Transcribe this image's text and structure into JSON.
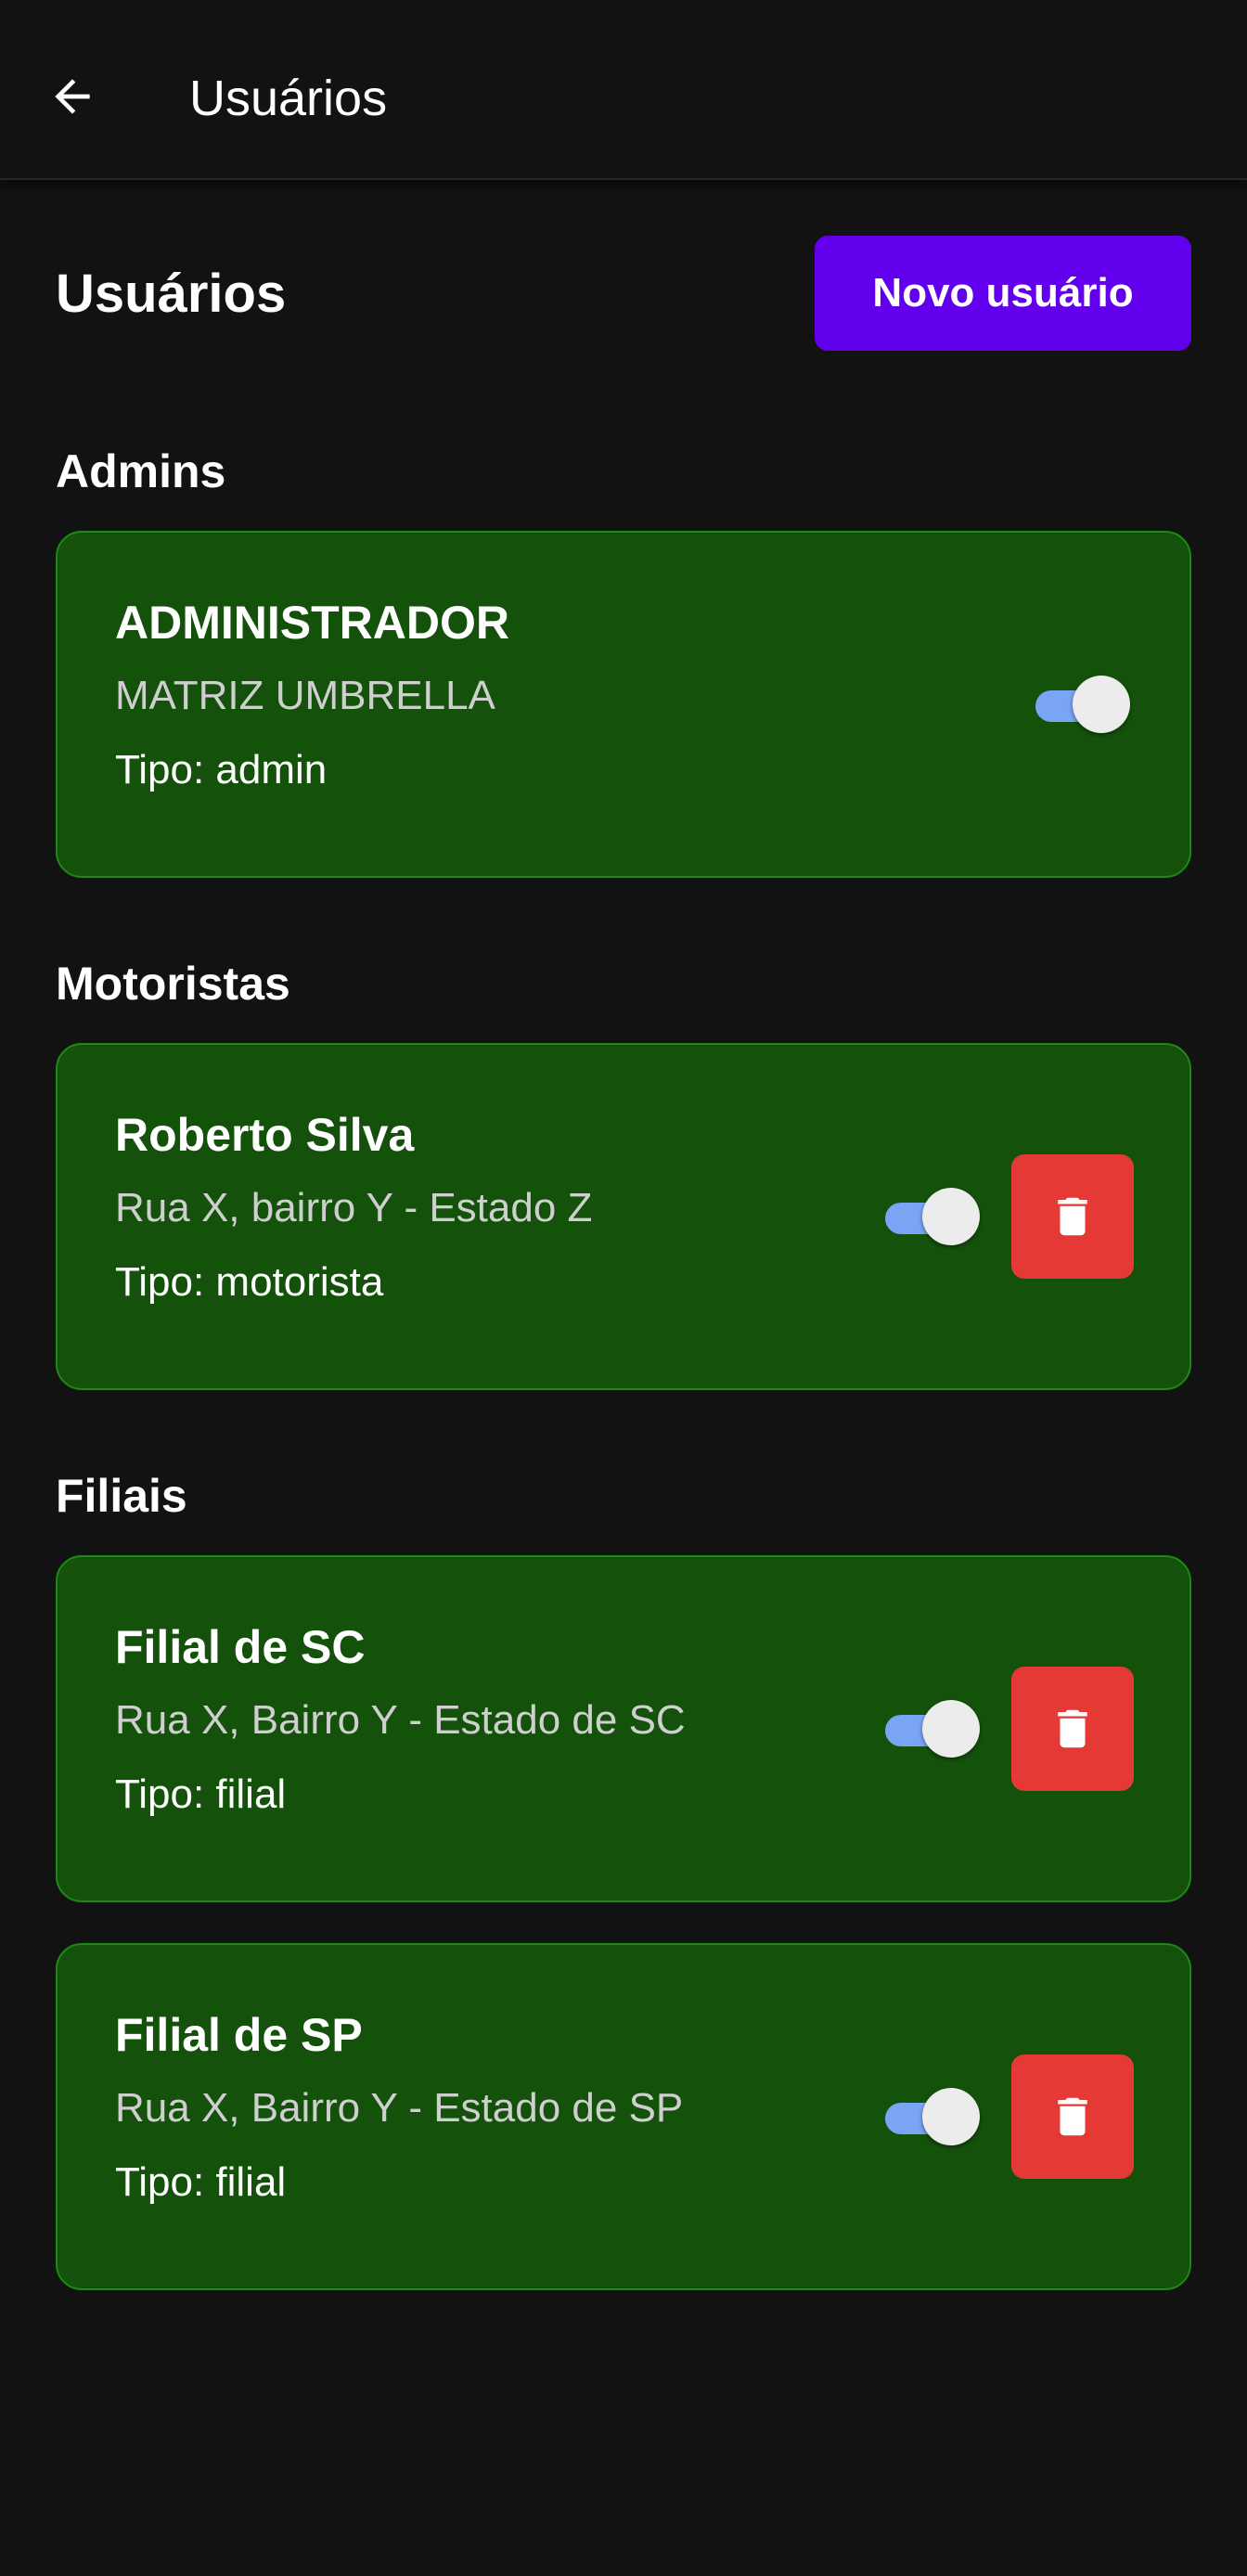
{
  "appbar": {
    "title": "Usuários",
    "back_icon": "arrow-left-icon"
  },
  "header": {
    "title": "Usuários",
    "new_user_label": "Novo usuário"
  },
  "colors": {
    "primary": "#6200ee",
    "card_bg": "#14520c",
    "card_border": "#1c8a14",
    "delete": "#e53935",
    "switch_track": "#7aa4f4"
  },
  "sections": [
    {
      "title": "Admins",
      "users": [
        {
          "name": "ADMINISTRADOR",
          "address": "MATRIZ UMBRELLA",
          "type": "Tipo: admin",
          "active": true,
          "deletable": false
        }
      ]
    },
    {
      "title": "Motoristas",
      "users": [
        {
          "name": "Roberto Silva",
          "address": "Rua X, bairro Y - Estado Z",
          "type": "Tipo: motorista",
          "active": true,
          "deletable": true
        }
      ]
    },
    {
      "title": "Filiais",
      "users": [
        {
          "name": "Filial de SC",
          "address": "Rua X, Bairro Y - Estado de SC",
          "type": "Tipo: filial",
          "active": true,
          "deletable": true
        },
        {
          "name": "Filial de SP",
          "address": "Rua X, Bairro Y - Estado de SP",
          "type": "Tipo: filial",
          "active": true,
          "deletable": true
        }
      ]
    }
  ]
}
